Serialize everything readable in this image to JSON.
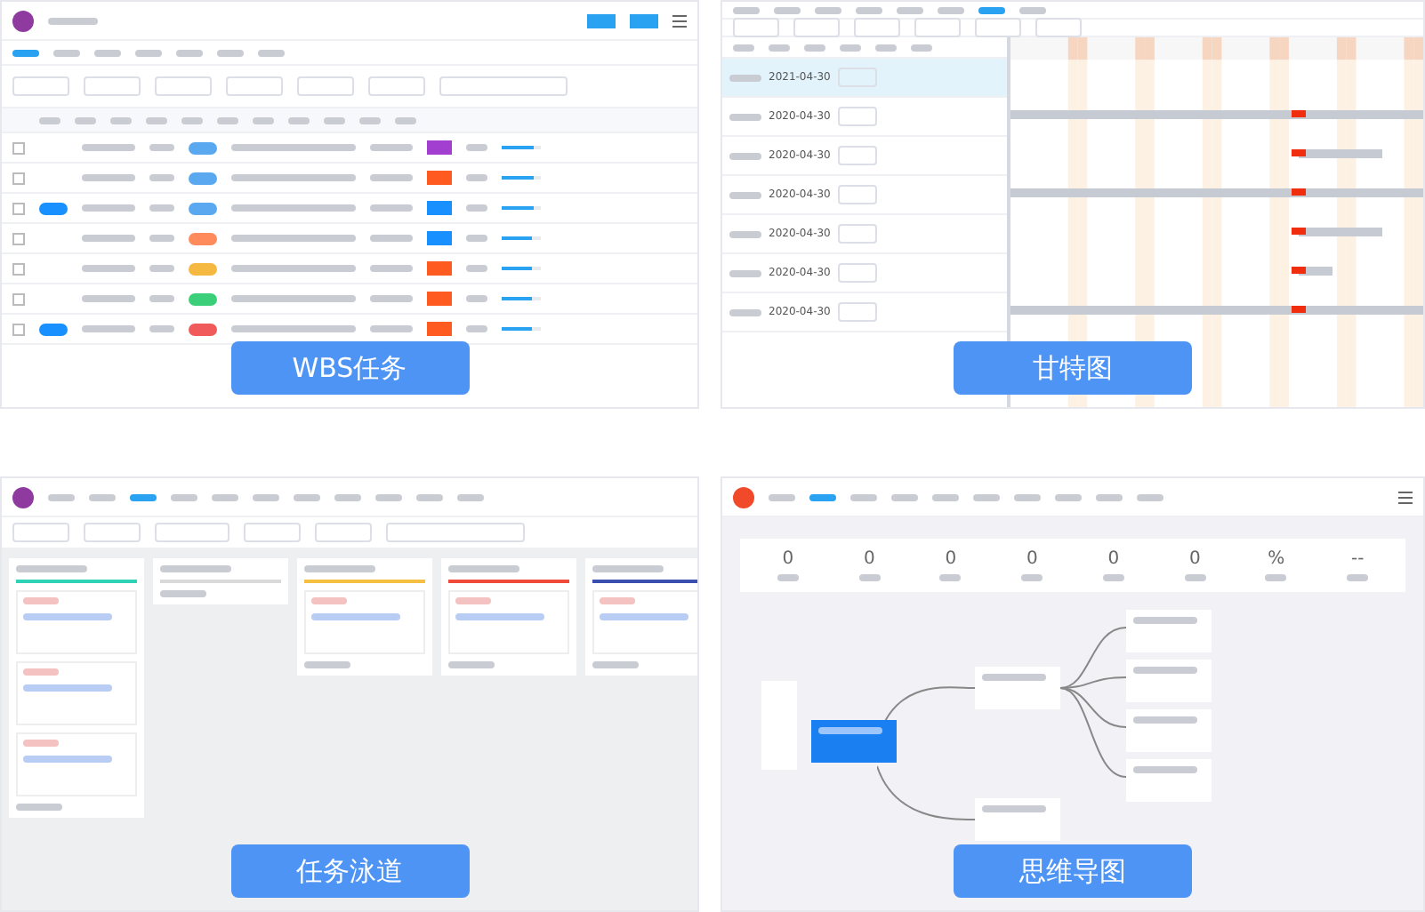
{
  "panels": [
    {
      "kind": "wbs",
      "caption": "WBS任务",
      "tabs": [
        {
          "selected": true
        },
        {
          "selected": false
        },
        {
          "selected": false
        },
        {
          "selected": false
        },
        {
          "selected": false
        },
        {
          "selected": false
        },
        {
          "selected": false
        }
      ],
      "rows": [
        {
          "checked": false,
          "level": 0.8
        },
        {
          "checked": false,
          "level": 0.8
        },
        {
          "checked": false,
          "level": 0.8
        },
        {
          "checked": false,
          "level": 0.75
        },
        {
          "checked": false,
          "level": 0.75
        },
        {
          "checked": false,
          "level": 0.75
        },
        {
          "checked": false,
          "level": 0.75
        }
      ]
    },
    {
      "kind": "gantt",
      "caption": "甘特图",
      "tabs": [
        {
          "selected": false
        },
        {
          "selected": false
        },
        {
          "selected": false
        },
        {
          "selected": false
        },
        {
          "selected": false
        },
        {
          "selected": false
        },
        {
          "selected": true
        },
        {
          "selected": false
        }
      ],
      "rows": [
        {
          "end": "2021-04-30",
          "selected": true
        },
        {
          "end": "2020-04-30",
          "selected": false
        },
        {
          "end": "2020-04-30",
          "selected": false
        },
        {
          "end": "2020-04-30",
          "selected": false
        },
        {
          "end": "2020-04-30",
          "selected": false
        },
        {
          "end": "2020-04-30",
          "selected": false
        },
        {
          "end": "2020-04-30",
          "selected": false
        }
      ]
    },
    {
      "kind": "kanban",
      "caption": "任务泳道",
      "tabs": [
        {
          "selected": false
        },
        {
          "selected": false
        },
        {
          "selected": true
        },
        {
          "selected": false
        },
        {
          "selected": false
        },
        {
          "selected": false
        },
        {
          "selected": false
        },
        {
          "selected": false
        },
        {
          "selected": false
        },
        {
          "selected": false
        },
        {
          "selected": false
        }
      ],
      "lanes": [
        {
          "color": "#2ed3b7",
          "cards": [
            {
              "kind": "task"
            },
            {
              "kind": "task"
            },
            {
              "kind": "task"
            }
          ]
        },
        {
          "color": "#d9d9d9"
        },
        {
          "color": "#f5c042",
          "cards": [
            {
              "kind": "task"
            }
          ]
        },
        {
          "color": "#f04a3a",
          "cards": [
            {
              "kind": "task"
            }
          ]
        },
        {
          "color": "#3a4fb0",
          "cards": [
            {
              "kind": "task"
            }
          ]
        }
      ]
    },
    {
      "kind": "mindmap",
      "caption": "思维导图",
      "tabs": [
        {
          "selected": false
        },
        {
          "selected": true
        },
        {
          "selected": false
        },
        {
          "selected": false
        },
        {
          "selected": false
        },
        {
          "selected": false
        },
        {
          "selected": false
        },
        {
          "selected": false
        },
        {
          "selected": false
        },
        {
          "selected": false
        }
      ],
      "stats": [
        "0",
        "0",
        "0",
        "0",
        "0",
        "0",
        "%",
        "--"
      ]
    }
  ]
}
